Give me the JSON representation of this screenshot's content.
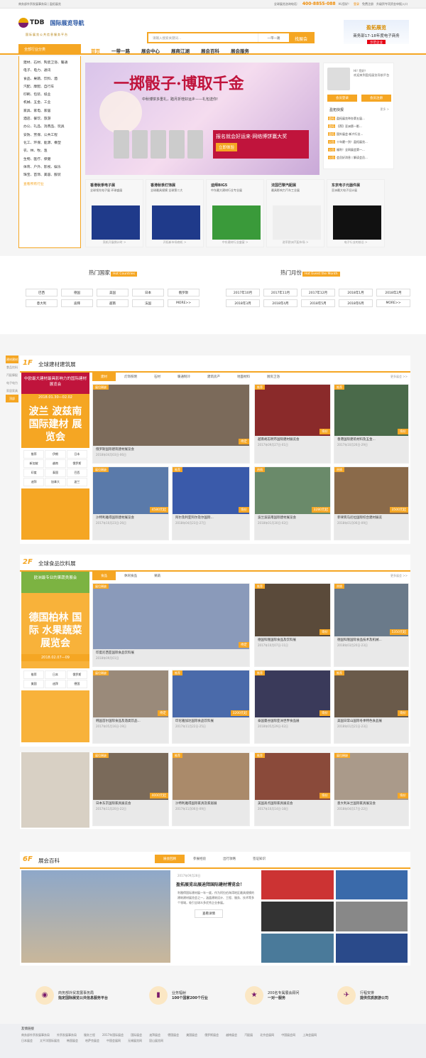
{
  "topbar": {
    "left": "商务部外贸发展事务局 | 盈拓展览",
    "hotline_label": "全球展览咨询电话：",
    "hotline": "400-8855-088",
    "greeting": "Hi,您好！",
    "login": "登录",
    "register": "免费注册",
    "fav": "升级贸专项资金申报入口"
  },
  "logo": {
    "tdb": "TDB",
    "cn": "国际展览导航",
    "url": "www.showguide.cn",
    "slogan": "国际展览公共信息服务平台"
  },
  "search": {
    "placeholder": "请输入搜索关键词...",
    "category": "一带一路",
    "button": "找展会"
  },
  "promo": {
    "a": "盈拓展览",
    "b": "商务部17-18年度电子商务",
    "c": "示范企业"
  },
  "nav": {
    "all": "全部行业分类",
    "items": [
      "首页",
      "一带一路",
      "展会中心",
      "展商江湖",
      "展会百科",
      "展会服务"
    ]
  },
  "menu": [
    "建材、石材、陶瓷卫浴、暖通",
    "电子、电力、通讯",
    "食品、果蔬、饮料、酒",
    "汽配、摩配、自行车",
    "印刷、包装、纸业",
    "机械、五金、工业",
    "家具、家电、家居",
    "酒店、餐饮、旅游",
    "办公、礼品、消费品、玩具",
    "安防、劳保、公共工程",
    "化工、环保、能源、橡塑",
    "农、林、牧、渔",
    "生物、医疗、保健",
    "体育、户外、影视、娱乐",
    "珠宝、首饰、美容、服装"
  ],
  "menu_more": "查看所有行业",
  "banner": {
    "title": "一掷骰子·博取千金",
    "sub": "中秋博饼多重礼，踏月折桂好运乡——礼包送你!",
    "offer": "报名就会好运来·网络博饼赢大奖",
    "cta": "立即体验"
  },
  "panel": {
    "hi": "Hi! 您好！",
    "welcome": "欢迎来到盈拓展览导航平台",
    "login": "会员登录",
    "register": "会员注册",
    "news_title": "盈拓快报",
    "news_more": "更多 >",
    "news": [
      {
        "t": "盈拓",
        "x": "盈拓展览举办第五届..."
      },
      {
        "t": "盈拓",
        "x": "【荐】亚洲第一影..."
      },
      {
        "t": "盈拓",
        "x": "国外展会-新兴行业..."
      },
      {
        "t": "公告",
        "x": "十年磨一剑！盈拓展览..."
      },
      {
        "t": "公告",
        "x": "福利！全网展会第一..."
      },
      {
        "t": "公告",
        "x": "会员好消息丨解读会员..."
      }
    ]
  },
  "cards": [
    {
      "t": "香港秋季电子展",
      "d": "全球领先电子展 环球盛展",
      "f": "亮机开展倒计时 >"
    },
    {
      "t": "香港秋季灯饰展",
      "d": "全球最具规模 全球第二大",
      "f": "开拓新市场商机 >"
    },
    {
      "t": "迪拜BIG5",
      "d": "中东最大建材行业专业展",
      "f": "中东建材行业盛宴 >"
    },
    {
      "t": "法国巴黎汽配展",
      "d": "最具影响力汽车工业展",
      "f": "进军欧洲汽配市场 >"
    },
    {
      "t": "东京电子元器件展",
      "d": "亚洲最大电子设计展",
      "f": "电子行业的前沿 >"
    }
  ],
  "hot": {
    "countries_title": "热门国家",
    "countries_en": "Hot Countries",
    "months_title": "热门月份",
    "months_en": "Hot Event the Month",
    "countries": [
      "巴西",
      "德国",
      "美国",
      "日本",
      "俄罗斯",
      "意大利",
      "迪拜",
      "越南",
      "法国",
      "MORE>>"
    ],
    "months": [
      "2017年10月",
      "2017年11月",
      "2017年12月",
      "2018年1月",
      "2018年2月",
      "2018年3月",
      "2018年4月",
      "2018年5月",
      "2018年6月",
      "MORE>>"
    ]
  },
  "floor1": {
    "no": "1F",
    "name": "全球建材建筑展",
    "more": "更多展会 >>",
    "tabs": [
      "建材",
      "灯饰照明",
      "石材",
      "暖通制冷",
      "建筑房产",
      "地面材料",
      "厨房卫浴"
    ],
    "promo_top": "中欧最大建材最具影响力的国际建材展览会",
    "promo_date": "2018.01.30—02.02",
    "promo_big": "波兰 波兹南 国际建材 展览会",
    "tags": [
      "推荐",
      "伊朗",
      "日本",
      "新加坡",
      "越南",
      "俄罗斯",
      "印度",
      "泰国",
      "巴西",
      "迪拜",
      "加拿大",
      "波兰"
    ],
    "tiles": [
      {
        "b": "展位稀缺",
        "t": "俄罗斯国际建筑建材展览会",
        "d": "2018年04月03日-06日",
        "p": "待定"
      },
      {
        "b": "推荐",
        "t": "越南胡志明市国际建材展览会",
        "d": "2017年09月27日-01日",
        "p": "询价"
      },
      {
        "b": "推荐",
        "t": "香港国际建筑材料及五金...",
        "d": "2017年10月26日-29日",
        "p": "询价"
      },
      {
        "b": "展位稀缺",
        "t": "沙特利雅得国际建材展览会",
        "d": "2017年10月23日-26日",
        "p": "4580元起"
      },
      {
        "b": "推荐",
        "t": "阿尔及利亚阿尔及尔国际...",
        "d": "2018年04月23日-27日",
        "p": "询价"
      },
      {
        "b": "热销",
        "t": "波兰波兹南国际建材展览会",
        "d": "2018年01月30日-02日",
        "p": "3280元起"
      },
      {
        "b": "热销",
        "t": "菲律宾马尼拉国际综合建材展览",
        "d": "2018年01月06日-09日",
        "p": "3500元起"
      }
    ]
  },
  "floor2": {
    "no": "2F",
    "name": "全球食品饮料展",
    "more": "更多展会 >>",
    "tabs": [
      "食品",
      "休闲食品",
      "果蔬"
    ],
    "promo_top": "欧洲最专业的果蔬类展会",
    "promo_date": "2018.02.07—09",
    "promo_big": "德国柏林 国际 水果蔬菜 展览会",
    "tags": [
      "推荐",
      "日本",
      "俄罗斯",
      "美国",
      "迪拜",
      "德国"
    ],
    "tiles": [
      {
        "b": "展位稀缺",
        "t": "印度尼西亚国际食品饮料展",
        "d": "2018年09月01日",
        "p": "待定"
      },
      {
        "b": "推荐",
        "t": "德国科隆国际食品及饮料展",
        "d": "2017年10月07日-11日",
        "p": "询价"
      },
      {
        "b": "热销",
        "t": "德国科隆国际食品技术及机械...",
        "d": "2018年03月20日-23日",
        "p": "5350元起"
      },
      {
        "b": "展位稀缺",
        "t": "韩国首尔国际食品及酒类饮品...",
        "d": "2017年05月16日-19日",
        "p": "待定"
      },
      {
        "b": "推荐",
        "t": "印尼雅加达国际食品饮料展",
        "d": "2017年11月22日-25日",
        "p": "3200元起"
      },
      {
        "b": "推荐",
        "t": "泰国曼谷国际亚洲世界食品展",
        "d": "2018年05月29日-02日",
        "p": "询价"
      },
      {
        "b": "推荐",
        "t": "美国日常山国际冬季特色食品展",
        "d": "2018年01月21日-23日",
        "p": "询价"
      }
    ]
  },
  "floor3": {
    "tiles": [
      {
        "b": "展位稀缺",
        "t": "日本东京国际家具展览会",
        "d": "2017年11月20日-22日",
        "p": "4000元起"
      },
      {
        "b": "推荐",
        "t": "沙特利雅得国际家具及家居展",
        "d": "2017年11月06日-09日",
        "p": "询价"
      },
      {
        "b": "推荐",
        "t": "美国高点国际家具展览会",
        "d": "2017年10月14日-18日",
        "p": "询价"
      },
      {
        "b": "展位稀缺",
        "t": "意大利米兰国际家具展览会",
        "d": "2018年04月17日-22日",
        "p": "询价"
      }
    ]
  },
  "rail": [
    "建材建材",
    "食品饮料",
    "汽配摩配",
    "电子电力",
    "家居家具",
    "顶部"
  ],
  "wiki": {
    "no": "6F",
    "name": "展会百科",
    "tabs": [
      "展会回顾",
      "参展经验",
      "出行攻略",
      "签证知识"
    ],
    "date": "2017年09月28日",
    "title": "盈拓展览出展迪拜国际建材博览会！",
    "body": "利雅得国际建材展一年一度，作为阿拉伯海湾地区最具规模的建筑建材展览会之一，涵盖建筑设计、工程、服务、技术等多个领域，吸引全球众多优秀企业参展。",
    "btn": "查看详情"
  },
  "features": [
    {
      "icon": "◉",
      "a": "商务部外贸发展事务局",
      "b": "指定国际展览公共信息服务平台"
    },
    {
      "icon": "▮",
      "a": "业务辐射",
      "b": "100个国家200个行业"
    },
    {
      "icon": "★",
      "a": "200名专属展会顾问",
      "b": "一对一服务"
    },
    {
      "icon": "✈",
      "a": "行程安排",
      "b": "提供优质旅游公司"
    }
  ],
  "footer": {
    "h": "友情链接",
    "links": [
      "商务部外贸发展事务局",
      "外贸发展事务局",
      "服务工程",
      "2017年国际展会",
      "国际展会",
      "迪拜展会",
      "德国展会",
      "美国展会",
      "俄罗斯展会",
      "越南展会",
      "汽配展",
      "北京会展网",
      "中国展会网",
      "上海会展网",
      "日本展会",
      "太平洋国际展览",
      "韩国展会",
      "哈萨克展会",
      "中国会展网",
      "无锡展览网",
      "昆山展览网"
    ]
  }
}
